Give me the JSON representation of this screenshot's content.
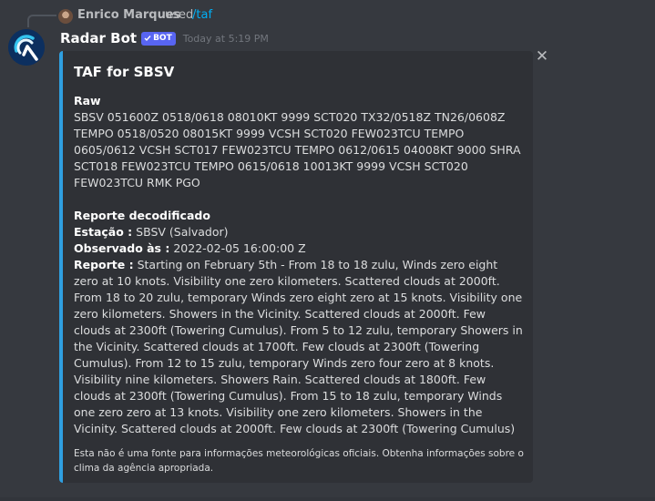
{
  "reply": {
    "username": "Enrico Marques",
    "used_text": "used",
    "command": "/taf"
  },
  "message": {
    "author": "Radar Bot",
    "bot_tag": "BOT",
    "timestamp": "Today at 5:19 PM"
  },
  "embed": {
    "accent_color": "#2f9fe0",
    "title": "TAF for SBSV",
    "raw_label": "Raw",
    "raw_text": "SBSV 051600Z 0518/0618 08010KT 9999 SCT020 TX32/0518Z TN26/0608Z TEMPO 0518/0520 08015KT 9999 VCSH SCT020 FEW023TCU TEMPO 0605/0612 VCSH SCT017 FEW023TCU TEMPO 0612/0615 04008KT 9000 SHRA SCT018 FEW023TCU TEMPO 0615/0618 10013KT 9999 VCSH SCT020 FEW023TCU RMK PGO",
    "decoded_label": "Reporte decodificado",
    "station_label": "Estação :",
    "station_value": "SBSV (Salvador)",
    "observed_label": "Observado às :",
    "observed_value": "2022-02-05 16:00:00 Z",
    "report_label": "Reporte :",
    "report_value": "Starting on February 5th - From 18 to 18 zulu, Winds zero eight zero at 10 knots. Visibility one zero kilometers. Scattered clouds at 2000ft. From 18 to 20 zulu, temporary Winds zero eight zero at 15 knots. Visibility one zero kilometers. Showers in the Vicinity. Scattered clouds at 2000ft. Few clouds at 2300ft (Towering Cumulus). From 5 to 12 zulu, temporary Showers in the Vicinity. Scattered clouds at 1700ft. Few clouds at 2300ft (Towering Cumulus). From 12 to 15 zulu, temporary Winds zero four zero at 8 knots. Visibility nine kilometers. Showers Rain. Scattered clouds at 1800ft. Few clouds at 2300ft (Towering Cumulus). From 15 to 18 zulu, temporary Winds one zero zero at 13 knots. Visibility one zero kilometers. Showers in the Vicinity. Scattered clouds at 2000ft. Few clouds at 2300ft (Towering Cumulus)",
    "footer": "Esta não é uma fonte para informações meteorológicas oficiais. Obtenha informações sobre o clima da agência apropriada."
  },
  "icons": {
    "close": "close-icon",
    "check": "check-icon",
    "bot_avatar": "radar-bot-logo"
  }
}
